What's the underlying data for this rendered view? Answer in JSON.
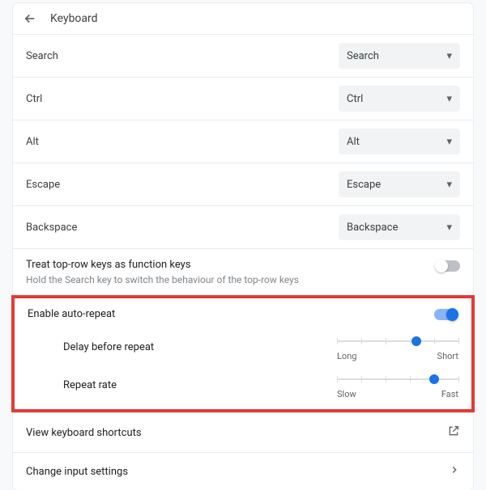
{
  "header": {
    "title": "Keyboard"
  },
  "keymaps": [
    {
      "label": "Search",
      "value": "Search"
    },
    {
      "label": "Ctrl",
      "value": "Ctrl"
    },
    {
      "label": "Alt",
      "value": "Alt"
    },
    {
      "label": "Escape",
      "value": "Escape"
    },
    {
      "label": "Backspace",
      "value": "Backspace"
    }
  ],
  "function_keys": {
    "label": "Treat top-row keys as function keys",
    "sub": "Hold the Search key to switch the behaviour of the top-row keys",
    "enabled": false
  },
  "auto_repeat": {
    "label": "Enable auto-repeat",
    "enabled": true,
    "delay": {
      "label": "Delay before repeat",
      "left": "Long",
      "right": "Short",
      "value_pct": 65
    },
    "rate": {
      "label": "Repeat rate",
      "left": "Slow",
      "right": "Fast",
      "value_pct": 80
    }
  },
  "links": {
    "shortcuts": "View keyboard shortcuts",
    "input": "Change input settings"
  }
}
